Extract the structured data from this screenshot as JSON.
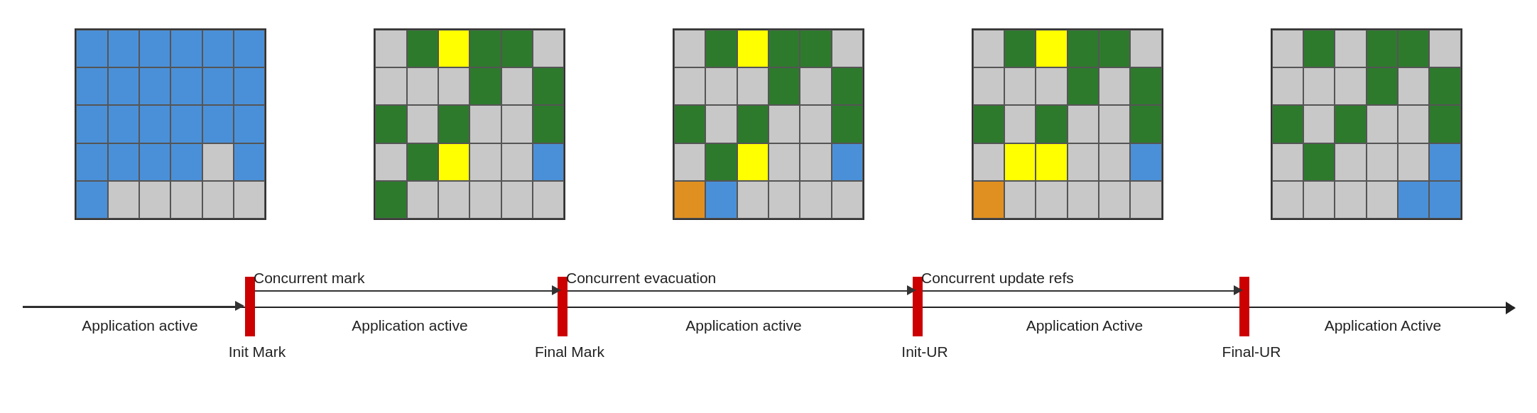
{
  "diagrams": [
    {
      "id": "diagram1",
      "cells": [
        "blue",
        "blue",
        "blue",
        "blue",
        "blue",
        "blue",
        "blue",
        "blue",
        "blue",
        "blue",
        "blue",
        "blue",
        "blue",
        "blue",
        "blue",
        "blue",
        "blue",
        "blue",
        "blue",
        "blue",
        "blue",
        "blue",
        "lightgray",
        "blue",
        "blue",
        "lightgray",
        "lightgray",
        "lightgray",
        "lightgray",
        "lightgray"
      ]
    },
    {
      "id": "diagram2",
      "cells": [
        "lightgray",
        "green",
        "yellow",
        "green",
        "green",
        "lightgray",
        "lightgray",
        "lightgray",
        "lightgray",
        "green",
        "lightgray",
        "green",
        "green",
        "lightgray",
        "green",
        "lightgray",
        "lightgray",
        "green",
        "lightgray",
        "green",
        "yellow",
        "lightgray",
        "lightgray",
        "blue",
        "green",
        "lightgray",
        "lightgray",
        "lightgray",
        "lightgray",
        "lightgray"
      ]
    },
    {
      "id": "diagram3",
      "cells": [
        "lightgray",
        "green",
        "yellow",
        "green",
        "green",
        "lightgray",
        "lightgray",
        "lightgray",
        "lightgray",
        "green",
        "lightgray",
        "green",
        "green",
        "lightgray",
        "green",
        "lightgray",
        "lightgray",
        "green",
        "lightgray",
        "green",
        "yellow",
        "lightgray",
        "lightgray",
        "blue",
        "orange",
        "blue",
        "lightgray",
        "lightgray",
        "lightgray",
        "lightgray"
      ]
    },
    {
      "id": "diagram4",
      "cells": [
        "lightgray",
        "green",
        "yellow",
        "green",
        "green",
        "lightgray",
        "lightgray",
        "lightgray",
        "lightgray",
        "green",
        "lightgray",
        "green",
        "green",
        "lightgray",
        "green",
        "lightgray",
        "lightgray",
        "green",
        "lightgray",
        "yellow",
        "yellow",
        "lightgray",
        "lightgray",
        "blue",
        "orange",
        "lightgray",
        "lightgray",
        "lightgray",
        "lightgray",
        "lightgray"
      ]
    },
    {
      "id": "diagram5",
      "cells": [
        "lightgray",
        "green",
        "lightgray",
        "green",
        "green",
        "lightgray",
        "lightgray",
        "lightgray",
        "lightgray",
        "green",
        "lightgray",
        "green",
        "green",
        "lightgray",
        "green",
        "lightgray",
        "lightgray",
        "green",
        "lightgray",
        "green",
        "lightgray",
        "lightgray",
        "lightgray",
        "blue",
        "lightgray",
        "lightgray",
        "lightgray",
        "lightgray",
        "blue",
        "blue"
      ]
    }
  ],
  "timeline": {
    "segments": [
      {
        "label_top": "",
        "label_bottom": "Application active",
        "from": 0,
        "to": 1
      },
      {
        "label_top": "Concurrent mark",
        "label_bottom": "Application active",
        "from": 1,
        "to": 2
      },
      {
        "label_top": "Concurrent evacuation",
        "label_bottom": "Application active",
        "from": 2,
        "to": 3
      },
      {
        "label_top": "Concurrent update refs",
        "label_bottom": "Application Active",
        "from": 3,
        "to": 4
      },
      {
        "label_top": "",
        "label_bottom": "Application Active",
        "from": 4,
        "to": 5
      }
    ],
    "markers": [
      {
        "label": "Init Mark",
        "position": 1
      },
      {
        "label": "Final Mark",
        "position": 2
      },
      {
        "label": "Init-UR",
        "position": 3
      },
      {
        "label": "Final-UR",
        "position": 4
      }
    ]
  }
}
